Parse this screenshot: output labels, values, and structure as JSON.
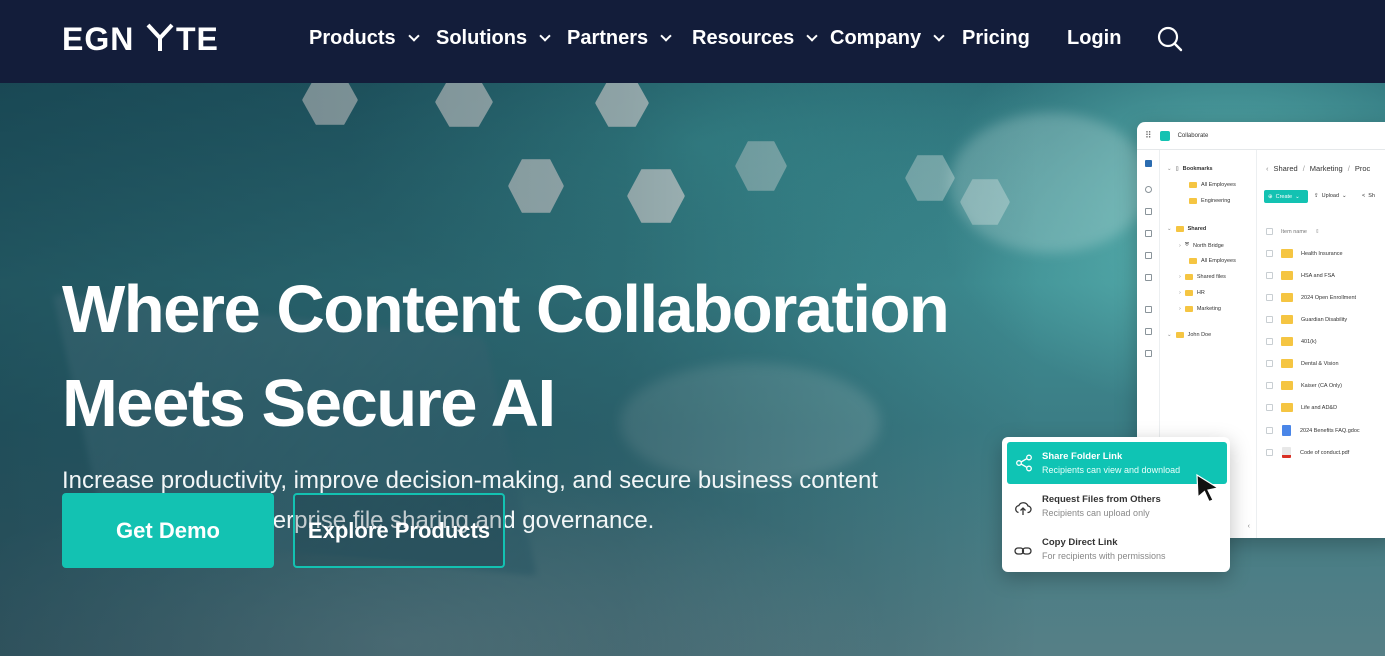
{
  "nav": {
    "logo_text": "EGNYTE",
    "items": [
      {
        "label": "Products",
        "dropdown": true
      },
      {
        "label": "Solutions",
        "dropdown": true
      },
      {
        "label": "Partners",
        "dropdown": true
      },
      {
        "label": "Resources",
        "dropdown": true
      },
      {
        "label": "Company",
        "dropdown": true
      },
      {
        "label": "Pricing",
        "dropdown": false
      },
      {
        "label": "Login",
        "dropdown": false
      }
    ],
    "search_icon": "search-icon"
  },
  "hero": {
    "headline_line1": "Where Content Collaboration",
    "headline_line2": "Meets Secure AI",
    "subtext_line1": "Increase productivity, improve decision-making, and secure business content",
    "subtext_line2": "with AI-powered enterprise file sharing and governance.",
    "primary_button": "Get Demo",
    "secondary_button": "Explore Products"
  },
  "app_preview": {
    "app_name": "Collaborate",
    "breadcrumb": [
      "Shared",
      "Marketing",
      "Proc"
    ],
    "create_label": "Create",
    "upload_label": "Upload",
    "share_label": "Sh",
    "column_header": "Item name",
    "tree": {
      "bookmarks_label": "Bookmarks",
      "bookmarks": [
        "All Employees",
        "Engineering"
      ],
      "shared_label": "Shared",
      "shared": [
        "North Bridge",
        "All Employees",
        "Shared files",
        "HR",
        "Marketing"
      ],
      "user": "John Doe"
    },
    "files": [
      "Health Insurance",
      "HSA and FSA",
      "2024 Open Enrollment",
      "Guardian Disability",
      "401(k)",
      "Dental & Vision",
      "Kaiser (CA Only)",
      "Life and AD&D",
      "2024 Benefits FAQ.gdoc",
      "Code of conduct.pdf"
    ]
  },
  "share_menu": {
    "items": [
      {
        "title": "Share Folder Link",
        "subtitle": "Recipients can view and download",
        "icon": "share-icon"
      },
      {
        "title": "Request Files from Others",
        "subtitle": "Recipients can upload only",
        "icon": "upload-cloud-icon"
      },
      {
        "title": "Copy Direct Link",
        "subtitle": "For recipients with permissions",
        "icon": "link-icon"
      }
    ]
  },
  "colors": {
    "nav_bg": "#131d3a",
    "accent": "#13c2b2",
    "menu_highlight": "#0fc4b4"
  }
}
